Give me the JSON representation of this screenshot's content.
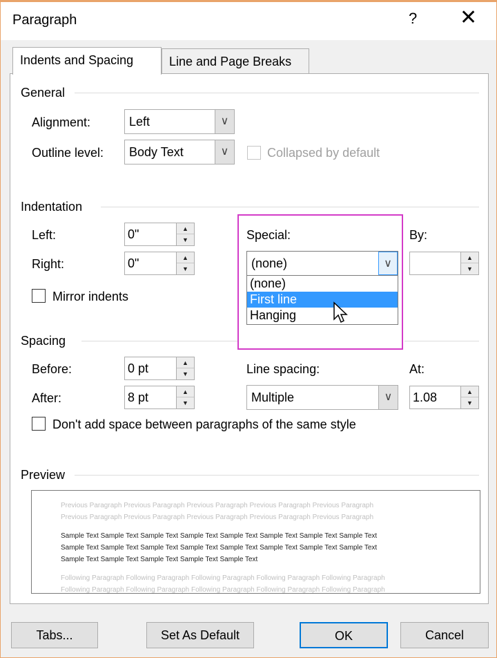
{
  "window": {
    "title": "Paragraph",
    "help": "?",
    "close": "✕"
  },
  "tabs": [
    {
      "label": "Indents and Spacing",
      "active": true
    },
    {
      "label": "Line and Page Breaks",
      "active": false
    }
  ],
  "general": {
    "heading": "General",
    "alignment_label": "Alignment:",
    "alignment_value": "Left",
    "outline_label": "Outline level:",
    "outline_value": "Body Text",
    "collapsed_label": "Collapsed by default"
  },
  "indentation": {
    "heading": "Indentation",
    "left_label": "Left:",
    "left_value": "0\"",
    "right_label": "Right:",
    "right_value": "0\"",
    "special_label": "Special:",
    "special_value": "(none)",
    "by_label": "By:",
    "by_value": "",
    "mirror_label": "Mirror indents",
    "special_options": [
      "(none)",
      "First line",
      "Hanging"
    ],
    "special_highlighted": "First line"
  },
  "spacing": {
    "heading": "Spacing",
    "before_label": "Before:",
    "before_value": "0 pt",
    "after_label": "After:",
    "after_value": "8 pt",
    "line_spacing_label": "Line spacing:",
    "line_spacing_value": "Multiple",
    "at_label": "At:",
    "at_value": "1.08",
    "dont_add_label": "Don't add space between paragraphs of the same style"
  },
  "preview": {
    "heading": "Preview",
    "previous_lines": [
      "Previous Paragraph Previous Paragraph Previous Paragraph Previous Paragraph Previous Paragraph",
      "Previous Paragraph Previous Paragraph Previous Paragraph Previous Paragraph Previous Paragraph"
    ],
    "sample_lines": [
      "Sample Text Sample Text Sample Text Sample Text Sample Text Sample Text Sample Text Sample Text",
      "Sample Text Sample Text Sample Text Sample Text Sample Text Sample Text Sample Text Sample Text",
      "Sample Text Sample Text Sample Text Sample Text Sample Text"
    ],
    "following_lines": [
      "Following Paragraph Following Paragraph Following Paragraph Following Paragraph Following Paragraph",
      "Following Paragraph Following Paragraph Following Paragraph Following Paragraph Following Paragraph"
    ]
  },
  "buttons": {
    "tabs": "Tabs...",
    "set_default": "Set As Default",
    "ok": "OK",
    "cancel": "Cancel"
  },
  "colors": {
    "accent": "#0078d7",
    "highlight": "#d33bc8",
    "selection": "#3399ff"
  },
  "icons": {
    "dropdown": "chevron-down-icon",
    "spinner": "spinner-arrows-icon",
    "cursor": "mouse-pointer-icon"
  }
}
